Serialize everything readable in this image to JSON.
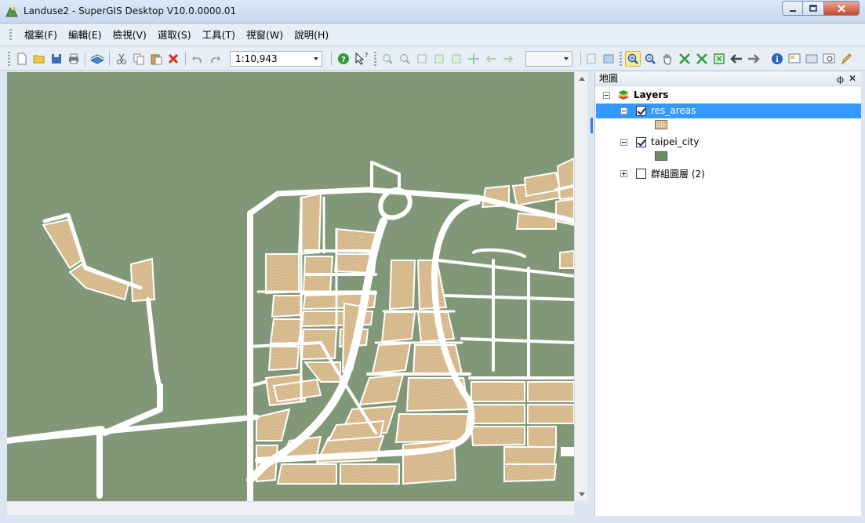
{
  "window": {
    "title": "Landuse2 - SuperGIS Desktop V10.0.0000.01"
  },
  "menu": {
    "items": [
      "檔案(F)",
      "編輯(E)",
      "檢視(V)",
      "選取(S)",
      "工具(T)",
      "視窗(W)",
      "說明(H)"
    ]
  },
  "toolbar": {
    "scale": "1:10,943",
    "tools": [
      "new-document",
      "open-folder",
      "save",
      "print",
      "add-data",
      "cut",
      "copy",
      "paste",
      "delete",
      "undo",
      "redo",
      "help",
      "whats-this",
      "fixed-zoom-in",
      "fixed-zoom-out",
      "zoom-layer",
      "zoom-selected",
      "full-extent",
      "pan-fixed",
      "previous-extent",
      "next-extent",
      "zoom-in",
      "zoom-out",
      "pan",
      "full-extent-green",
      "zoom-extent-green",
      "fixed-extent",
      "back",
      "forward",
      "identify",
      "find",
      "measure",
      "overview",
      "editor"
    ]
  },
  "colors": {
    "map_background": "#809878",
    "residential_fill": "#d0b080",
    "road": "#ffffff",
    "selection": "#3399ff"
  },
  "toc": {
    "title": "地圖",
    "root_label": "Layers",
    "layers": [
      {
        "name": "res_areas",
        "checked": true,
        "selected": true,
        "symbol": "dotted-tan-polygon"
      },
      {
        "name": "taipei_city",
        "checked": true,
        "selected": false,
        "symbol": "green-polygon"
      },
      {
        "name": "群組圖層 (2)",
        "checked": false,
        "selected": false,
        "symbol": ""
      }
    ]
  }
}
